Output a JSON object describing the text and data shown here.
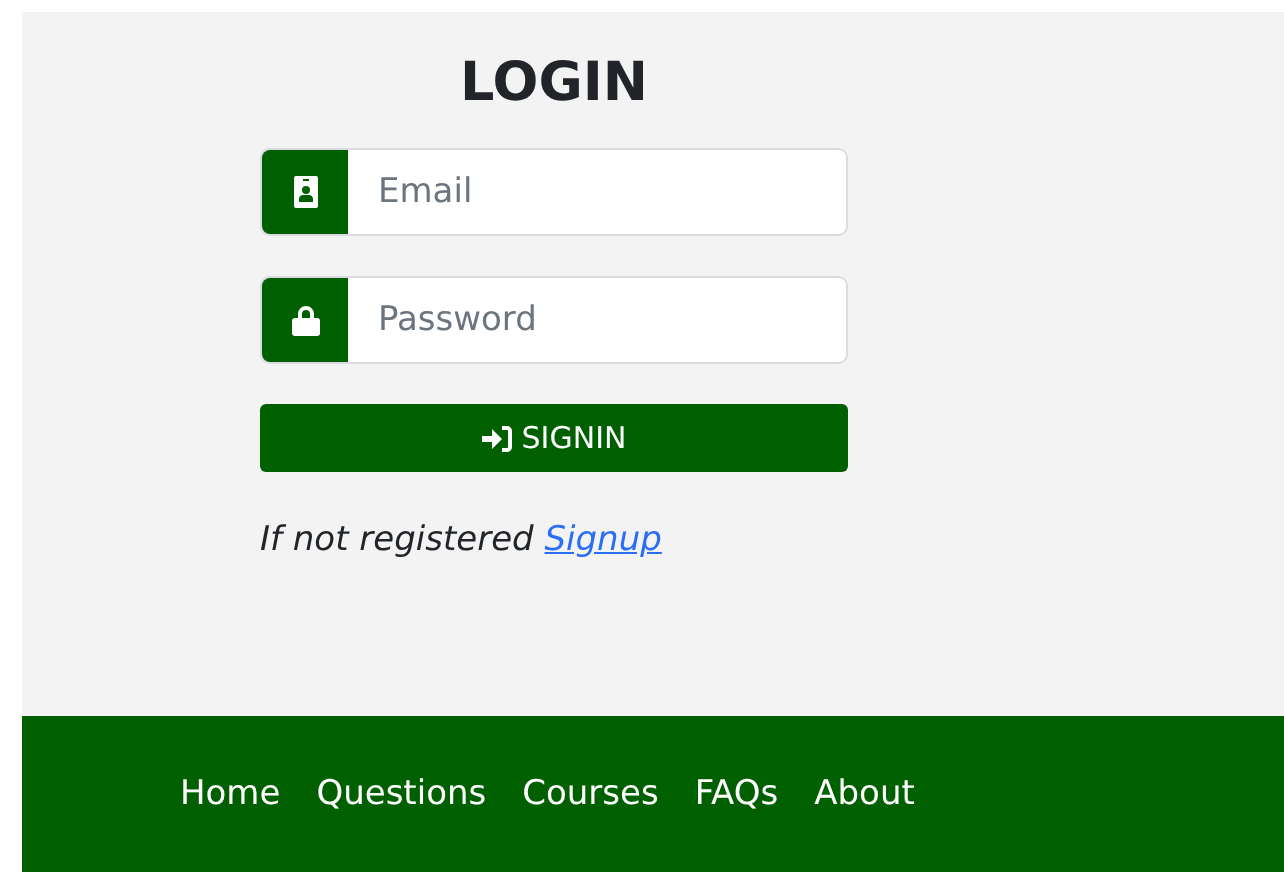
{
  "login": {
    "title": "LOGIN",
    "fields": [
      {
        "kind": "email",
        "placeholder": "Email"
      },
      {
        "kind": "password",
        "placeholder": "Password"
      }
    ],
    "submit": {
      "label": "SIGNIN"
    },
    "register_note": {
      "text": "If not registered",
      "link": "Signup"
    }
  },
  "footer": {
    "links": [
      "Home",
      "Questions",
      "Courses",
      "FAQs",
      "About"
    ]
  }
}
